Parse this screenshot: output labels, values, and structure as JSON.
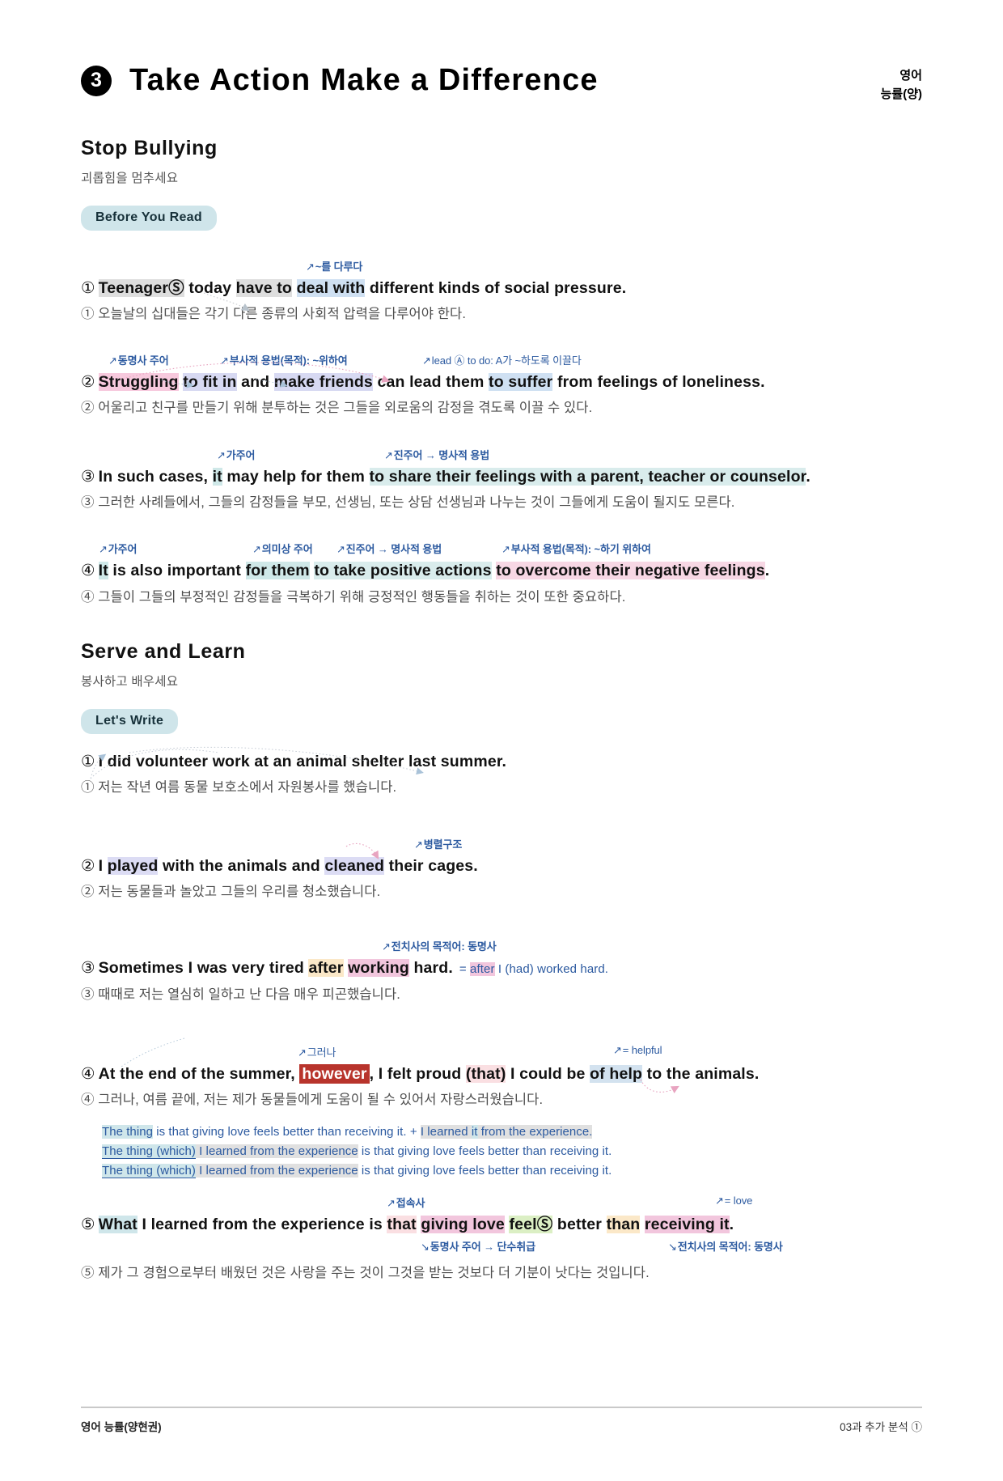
{
  "header": {
    "chapter_number": "3",
    "title": "Take Action Make a Difference",
    "corner_line1": "영어",
    "corner_line2": "능률(양)"
  },
  "sections": [
    {
      "title": "Stop Bullying",
      "subtitle": "괴롭힘을 멈추세요",
      "pill": "Before You Read"
    },
    {
      "title": "Serve and Learn",
      "subtitle": "봉사하고 배우세요",
      "pill": "Let's Write"
    }
  ],
  "part1": {
    "s1": {
      "num": "①",
      "note1": "~를 다루다",
      "t1": "Teenager",
      "t1s": "Ⓢ",
      "t2": " today ",
      "t3": "have to",
      "t4": " ",
      "t5": "deal with",
      "t6": " different kinds of social pressure.",
      "ko": "① 오늘날의 십대들은 각기 다른 종류의 사회적 압력을 다루어야 한다."
    },
    "s2": {
      "num": "②",
      "note1": "동명사 주어",
      "note2": "부사적 용법(목적): ~위하여",
      "note3": "lead Ⓐ to do: A가 ~하도록 이끌다",
      "t1": "Struggling",
      "t2": " ",
      "t3": "to fit in",
      "t4": " and ",
      "t5": "make friends",
      "t6": " can lead them ",
      "t7": "to suffer",
      "t8": " from feelings of loneliness.",
      "ko": "② 어울리고 친구를 만들기 위해 분투하는 것은 그들을 외로움의 감정을 겪도록 이끌 수 있다."
    },
    "s3": {
      "num": "③",
      "note1": "가주어",
      "note2": "진주어 → 명사적 용법",
      "t1": "In such cases, ",
      "t2": "it",
      "t3": " may help for them ",
      "t4": "to share their feelings with a parent, teacher or counselor",
      "t5": ".",
      "ko": "③ 그러한 사례들에서, 그들의 감정들을 부모, 선생님, 또는 상담 선생님과 나누는 것이 그들에게 도움이 될지도 모른다."
    },
    "s4": {
      "num": "④",
      "note1": "가주어",
      "note2": "의미상 주어",
      "note3": "진주어 → 명사적 용법",
      "note4": "부사적 용법(목적): ~하기 위하여",
      "t1": "It",
      "t2": " is also important ",
      "t3": "for them",
      "t4": " ",
      "t5": "to take positive actions",
      "t6": " ",
      "t7": "to overcome their negative feelings",
      "t8": ".",
      "ko": "④ 그들이 그들의 부정적인 감정들을 극복하기 위해 긍정적인 행동들을 취하는 것이 또한 중요하다."
    }
  },
  "part2": {
    "s1": {
      "num": "①",
      "t1": "I did volunteer work at an animal shelter last summer.",
      "ko": "① 저는 작년 여름 동물 보호소에서 자원봉사를 했습니다."
    },
    "s2": {
      "num": "②",
      "note1": "병렬구조",
      "t1": "I ",
      "t2": "played",
      "t3": " with the animals and ",
      "t4": "cleaned",
      "t5": " their cages.",
      "ko": "② 저는 동물들과 놀았고 그들의 우리를 청소했습니다."
    },
    "s3": {
      "num": "③",
      "note1": "전치사의 목적어: 동명사",
      "t1": "Sometimes I was very tired ",
      "t2": "after",
      "t3": " ",
      "t4": "working",
      "t5": " hard.",
      "eq_prefix": "= ",
      "eq_hl": "after",
      "eq_rest": " I (had) worked hard.",
      "ko": "③ 때때로 저는 열심히 일하고 난 다음 매우 피곤했습니다."
    },
    "s4": {
      "num": "④",
      "note1": "그러나",
      "note2": "= helpful",
      "t1": "At the end of the summer, ",
      "t2": "however",
      "t3": ", I felt proud ",
      "t4": "(that)",
      "t5": " I could be ",
      "t6": "of help",
      "t7": " to the animals.",
      "ko": "④ 그러나, 여름 끝에, 저는 제가 동물들에게 도움이 될 수 있어서 자랑스러웠습니다."
    },
    "derivation": {
      "l1_a": "The thing",
      "l1_b": " is that giving love feels better than receiving it. + ",
      "l1_c": "I learned",
      "l1_d": " ",
      "l1_e": "it",
      "l1_f": " from the experience.",
      "l2_a": "The thing (which)",
      "l2_b": " I learned from the experience",
      "l2_c": " is that giving love feels better than receiving it.",
      "l3_a": "The thing (which)",
      "l3_b": " I learned from the experience",
      "l3_c": " is that giving love feels better than receiving it."
    },
    "s5": {
      "num": "⑤",
      "note1": "접속사",
      "note2": "= love",
      "note3": "동명사 주어 → 단수취급",
      "note4": "전치사의 목적어: 동명사",
      "t1": "What",
      "t2": " I learned from the experience is ",
      "t3": "that",
      "t4": " ",
      "t5": "giving love",
      "t6": " ",
      "t7": "feel",
      "t7s": "Ⓢ",
      "t8": " better ",
      "t9": "than",
      "t10": " ",
      "t11": "receiving it",
      "t12": ".",
      "ko": "⑤ 제가 그 경험으로부터 배웠던 것은 사랑을 주는 것이 그것을 받는 것보다 더 기분이 낫다는 것입니다."
    }
  },
  "footer": {
    "left": "영어 능률(양현권)",
    "right": "03과 추가 분석 ①"
  }
}
